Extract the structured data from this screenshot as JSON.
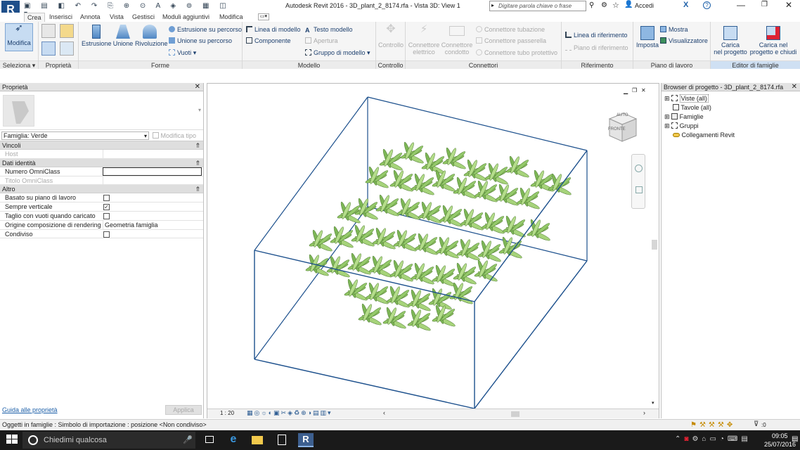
{
  "app": {
    "title": "Autodesk Revit 2016 -",
    "file_title": "3D_plant_2_8174.rfa - Vista 3D: View 1",
    "search_placeholder": "Digitare parola chiave o frase",
    "accedi": "Accedi"
  },
  "tabs": [
    "Crea",
    "Inserisci",
    "Annota",
    "Vista",
    "Gestisci",
    "Moduli aggiuntivi",
    "Modifica"
  ],
  "ribbon": {
    "modifica": "Modifica",
    "seleziona": "Seleziona",
    "proprieta": "Proprietà",
    "forme": {
      "title": "Forme",
      "estrusione": "Estrusione",
      "unione": "Unione",
      "rivoluzione": "Rivoluzione",
      "estrusione_percorso": "Estrusione su percorso",
      "unione_percorso": "Unione su percorso",
      "vuoti": "Vuoti"
    },
    "modello": {
      "title": "Modello",
      "linea": "Linea di modello",
      "componente": "Componente",
      "testo": "Testo modello",
      "apertura": "Apertura",
      "gruppo": "Gruppo di modello"
    },
    "controllo": {
      "title": "Controllo",
      "label": "Controllo"
    },
    "connettori": {
      "title": "Connettori",
      "elettrico_1": "Connettore",
      "elettrico_2": "elettrico",
      "condotto_1": "Connettore",
      "condotto_2": "condotto",
      "tubazione": "Connettore tubazione",
      "passerella": "Connettore passerella",
      "tubo": "Connettore tubo protettivo"
    },
    "riferimento": {
      "title": "Riferimento",
      "linea": "Linea di riferimento",
      "piano": "Piano di riferimento"
    },
    "piano_lavoro": {
      "title": "Piano di lavoro",
      "imposta": "Imposta",
      "mostra": "Mostra",
      "visualizzatore": "Visualizzatore"
    },
    "editor": {
      "title": "Editor di famiglie",
      "carica_1": "Carica",
      "carica_2": "nel progetto",
      "chiudi_1": "Carica nel",
      "chiudi_2": "progetto e chiudi"
    }
  },
  "properties": {
    "title": "Proprietà",
    "family": "Famiglia: Verde",
    "edit_type": "Modifica tipo",
    "sections": {
      "vincoli": "Vincoli",
      "dati": "Dati identità",
      "altro": "Altro"
    },
    "rows": {
      "host": "Host",
      "numero": "Numero OmniClass",
      "titolo": "Titolo OmniClass",
      "basato": "Basato su piano di lavoro",
      "sempre": "Sempre verticale",
      "taglio": "Taglio con vuoti quando caricato",
      "origine": "Origine composizione di rendering",
      "origine_val": "Geometria famiglia",
      "condiviso": "Condiviso"
    },
    "help_link": "Guida alle proprietà",
    "apply": "Applica"
  },
  "view": {
    "scale": "1 : 20",
    "cube_top": "AUTO",
    "cube_front": "FRONTE"
  },
  "browser": {
    "title": "Browser di progetto - 3D_plant_2_8174.rfa",
    "items": [
      "Viste (all)",
      "Tavole (all)",
      "Famiglie",
      "Gruppi",
      "Collegamenti Revit"
    ]
  },
  "status": {
    "text": "Oggetti in famiglie : Simbolo di importazione : posizione <Non condiviso>",
    "filter": ":0"
  },
  "taskbar": {
    "search": "Chiedimi qualcosa",
    "time": "09:05",
    "date": "25/07/2016"
  }
}
